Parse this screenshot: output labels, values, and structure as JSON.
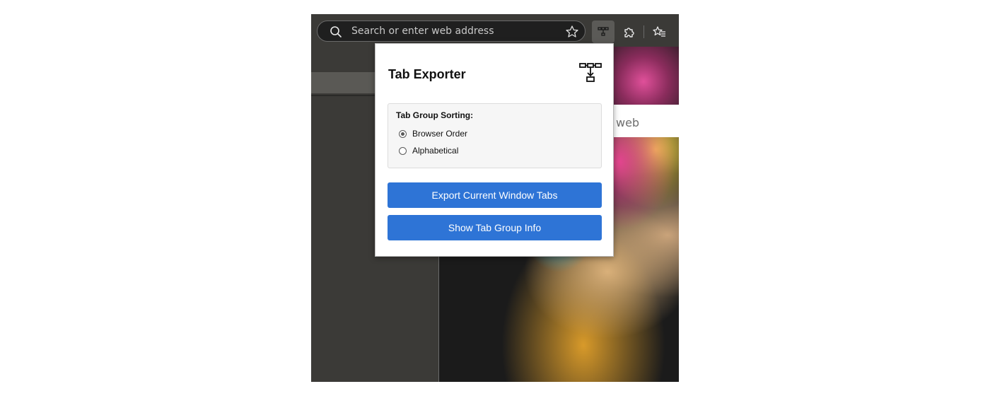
{
  "toolbar": {
    "address_placeholder": "Search or enter web address",
    "icons": [
      "search-icon",
      "favorite-star-icon",
      "tab-exporter-extension-icon",
      "extensions-puzzle-icon",
      "favorites-list-icon"
    ]
  },
  "page": {
    "partial_text": "web"
  },
  "popup": {
    "title": "Tab Exporter",
    "logo_icon": "tab-exporter-logo-icon",
    "sorting": {
      "label": "Tab Group Sorting:",
      "options": [
        {
          "label": "Browser Order",
          "checked": true
        },
        {
          "label": "Alphabetical",
          "checked": false
        }
      ]
    },
    "buttons": {
      "export": "Export Current Window Tabs",
      "show_info": "Show Tab Group Info"
    }
  },
  "colors": {
    "accent": "#2e74d6",
    "toolbar_bg": "#3b3a37"
  }
}
